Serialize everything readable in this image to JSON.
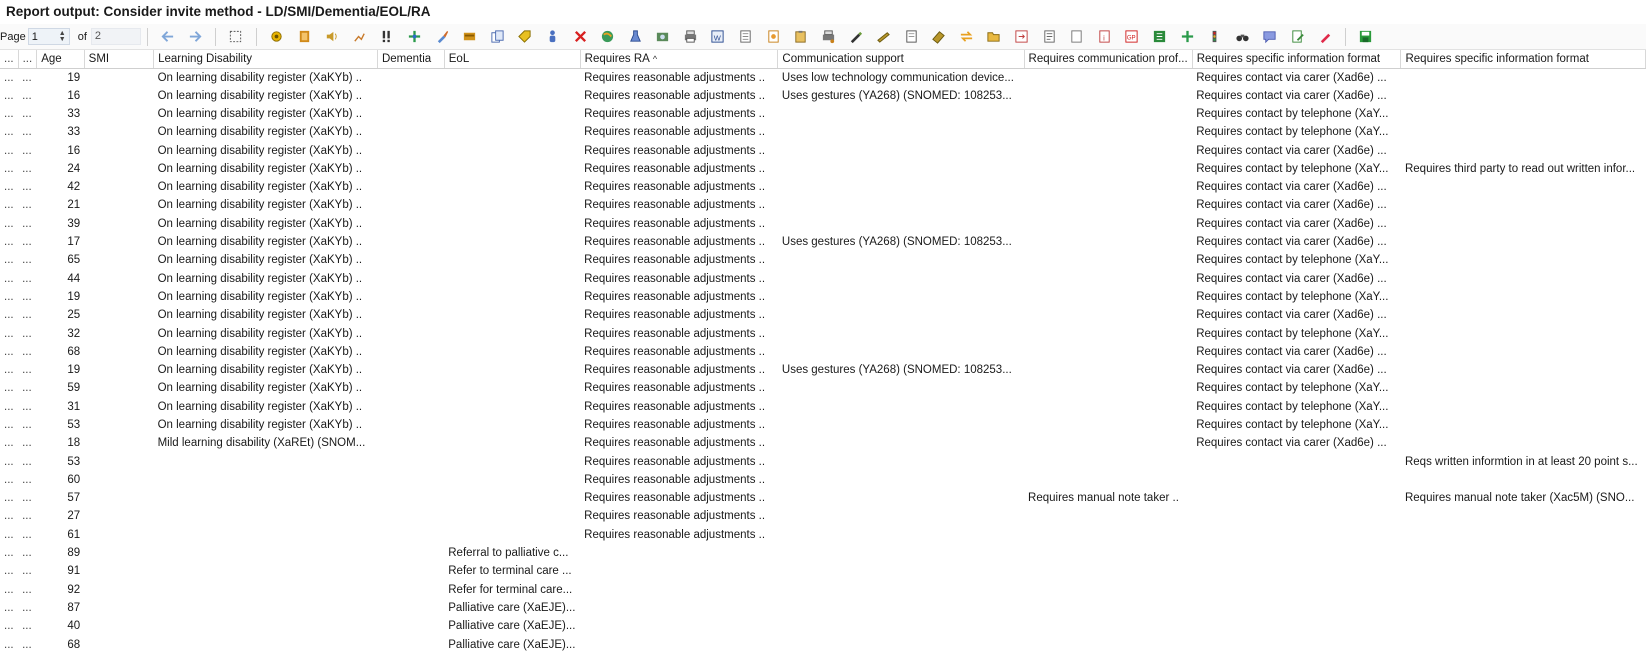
{
  "window": {
    "title": "Report output: Consider invite method - LD/SMI/Dementia/EOL/RA"
  },
  "pager": {
    "page_label": "Page",
    "page_value": "1",
    "of_label": "of",
    "total": "2"
  },
  "toolbar": {
    "icons": [
      "back-arrow-icon",
      "forward-arrow-icon",
      "select-icon",
      "sun-icon",
      "notebook-icon",
      "speaker-icon",
      "chart-edit-icon",
      "exclamation-icon",
      "add-icon",
      "brush-icon",
      "card-icon",
      "document-copy-icon",
      "tag-icon",
      "person-icon",
      "delete-icon",
      "globe-icon",
      "flask-icon",
      "camera-icon",
      "print-icon",
      "word-doc-icon",
      "sheet-icon",
      "report-icon",
      "clipboard-icon",
      "printer-settings-icon",
      "pen-icon",
      "wand-icon",
      "page-icon",
      "eraser-icon",
      "swap-icon",
      "folder-open-icon",
      "export-icon",
      "list-icon",
      "document-icon",
      "info-icon",
      "gp-icon",
      "spreadsheet-green-icon",
      "plus-green-icon",
      "traffic-light-icon",
      "binoculars-icon",
      "comment-icon",
      "edit-document-icon",
      "red-pen-icon",
      "save-icon"
    ]
  },
  "columns": [
    "...",
    "...",
    "Age",
    "SMI",
    "Learning Disability",
    "Dementia",
    "EoL",
    "Requires RA",
    "Communication support",
    "Requires communication prof...",
    "Requires specific information format",
    "Requires specific information format"
  ],
  "sort_indicator": "^",
  "rows": [
    [
      "...",
      "...",
      "19",
      "",
      "On learning disability register (XaKYb) ..",
      "",
      "",
      "Requires reasonable adjustments ..",
      "Uses low technology communication device...",
      "",
      "Requires contact via carer (Xad6e) ...",
      ""
    ],
    [
      "...",
      "...",
      "16",
      "",
      "On learning disability register (XaKYb) ..",
      "",
      "",
      "Requires reasonable adjustments ..",
      "Uses gestures (YA268) (SNOMED: 108253...",
      "",
      "Requires contact via carer (Xad6e) ...",
      ""
    ],
    [
      "...",
      "...",
      "33",
      "",
      "On learning disability register (XaKYb) ..",
      "",
      "",
      "Requires reasonable adjustments ..",
      "",
      "",
      "Requires contact by telephone (XaY...",
      ""
    ],
    [
      "...",
      "...",
      "33",
      "",
      "On learning disability register (XaKYb) ..",
      "",
      "",
      "Requires reasonable adjustments ..",
      "",
      "",
      "Requires contact by telephone (XaY...",
      ""
    ],
    [
      "...",
      "...",
      "16",
      "",
      "On learning disability register (XaKYb) ..",
      "",
      "",
      "Requires reasonable adjustments ..",
      "",
      "",
      "Requires contact via carer (Xad6e) ...",
      ""
    ],
    [
      "...",
      "...",
      "24",
      "",
      "On learning disability register (XaKYb) ..",
      "",
      "",
      "Requires reasonable adjustments ..",
      "",
      "",
      "Requires contact by telephone (XaY...",
      "Requires third party to read out written infor..."
    ],
    [
      "...",
      "...",
      "42",
      "",
      "On learning disability register (XaKYb) ..",
      "",
      "",
      "Requires reasonable adjustments ..",
      "",
      "",
      "Requires contact via carer (Xad6e) ...",
      ""
    ],
    [
      "...",
      "...",
      "21",
      "",
      "On learning disability register (XaKYb) ..",
      "",
      "",
      "Requires reasonable adjustments ..",
      "",
      "",
      "Requires contact via carer (Xad6e) ...",
      ""
    ],
    [
      "...",
      "...",
      "39",
      "",
      "On learning disability register (XaKYb) ..",
      "",
      "",
      "Requires reasonable adjustments ..",
      "",
      "",
      "Requires contact via carer (Xad6e) ...",
      ""
    ],
    [
      "...",
      "...",
      "17",
      "",
      "On learning disability register (XaKYb) ..",
      "",
      "",
      "Requires reasonable adjustments ..",
      "Uses gestures (YA268) (SNOMED: 108253...",
      "",
      "Requires contact via carer (Xad6e) ...",
      ""
    ],
    [
      "...",
      "...",
      "65",
      "",
      "On learning disability register (XaKYb) ..",
      "",
      "",
      "Requires reasonable adjustments ..",
      "",
      "",
      "Requires contact by telephone (XaY...",
      ""
    ],
    [
      "...",
      "...",
      "44",
      "",
      "On learning disability register (XaKYb) ..",
      "",
      "",
      "Requires reasonable adjustments ..",
      "",
      "",
      "Requires contact via carer (Xad6e) ...",
      ""
    ],
    [
      "...",
      "...",
      "19",
      "",
      "On learning disability register (XaKYb) ..",
      "",
      "",
      "Requires reasonable adjustments ..",
      "",
      "",
      "Requires contact by telephone (XaY...",
      ""
    ],
    [
      "...",
      "...",
      "25",
      "",
      "On learning disability register (XaKYb) ..",
      "",
      "",
      "Requires reasonable adjustments ..",
      "",
      "",
      "Requires contact via carer (Xad6e) ...",
      ""
    ],
    [
      "...",
      "...",
      "32",
      "",
      "On learning disability register (XaKYb) ..",
      "",
      "",
      "Requires reasonable adjustments ..",
      "",
      "",
      "Requires contact by telephone (XaY...",
      ""
    ],
    [
      "...",
      "...",
      "68",
      "",
      "On learning disability register (XaKYb) ..",
      "",
      "",
      "Requires reasonable adjustments ..",
      "",
      "",
      "Requires contact via carer (Xad6e) ...",
      ""
    ],
    [
      "...",
      "...",
      "19",
      "",
      "On learning disability register (XaKYb) ..",
      "",
      "",
      "Requires reasonable adjustments ..",
      "Uses gestures (YA268) (SNOMED: 108253...",
      "",
      "Requires contact via carer (Xad6e) ...",
      ""
    ],
    [
      "...",
      "...",
      "59",
      "",
      "On learning disability register (XaKYb) ..",
      "",
      "",
      "Requires reasonable adjustments ..",
      "",
      "",
      "Requires contact by telephone (XaY...",
      ""
    ],
    [
      "...",
      "...",
      "31",
      "",
      "On learning disability register (XaKYb) ..",
      "",
      "",
      "Requires reasonable adjustments ..",
      "",
      "",
      "Requires contact by telephone (XaY...",
      ""
    ],
    [
      "...",
      "...",
      "53",
      "",
      "On learning disability register (XaKYb) ..",
      "",
      "",
      "Requires reasonable adjustments ..",
      "",
      "",
      "Requires contact by telephone (XaY...",
      ""
    ],
    [
      "...",
      "...",
      "18",
      "",
      "Mild learning disability (XaREt) (SNOM...",
      "",
      "",
      "Requires reasonable adjustments ..",
      "",
      "",
      "Requires contact via carer (Xad6e) ...",
      ""
    ],
    [
      "...",
      "...",
      "53",
      "",
      "",
      "",
      "",
      "Requires reasonable adjustments ..",
      "",
      "",
      "",
      "Reqs written informtion in at least 20 point s..."
    ],
    [
      "...",
      "...",
      "60",
      "",
      "",
      "",
      "",
      "Requires reasonable adjustments ..",
      "",
      "",
      "",
      ""
    ],
    [
      "...",
      "...",
      "57",
      "",
      "",
      "",
      "",
      "Requires reasonable adjustments ..",
      "",
      "Requires manual note taker ..",
      "",
      "Requires manual note taker (Xac5M) (SNO..."
    ],
    [
      "...",
      "...",
      "27",
      "",
      "",
      "",
      "",
      "Requires reasonable adjustments ..",
      "",
      "",
      "",
      ""
    ],
    [
      "...",
      "...",
      "61",
      "",
      "",
      "",
      "",
      "Requires reasonable adjustments ..",
      "",
      "",
      "",
      ""
    ],
    [
      "...",
      "...",
      "89",
      "",
      "",
      "",
      "Referral to palliative c...",
      "",
      "",
      "",
      "",
      ""
    ],
    [
      "...",
      "...",
      "91",
      "",
      "",
      "",
      "Refer to terminal care ...",
      "",
      "",
      "",
      "",
      ""
    ],
    [
      "...",
      "...",
      "92",
      "",
      "",
      "",
      "Refer for terminal care...",
      "",
      "",
      "",
      "",
      ""
    ],
    [
      "...",
      "...",
      "87",
      "",
      "",
      "",
      "Palliative care (XaEJE)...",
      "",
      "",
      "",
      "",
      ""
    ],
    [
      "...",
      "...",
      "40",
      "",
      "",
      "",
      "Palliative care (XaEJE)...",
      "",
      "",
      "",
      "",
      ""
    ],
    [
      "...",
      "...",
      "68",
      "",
      "",
      "",
      "Palliative care (XaEJE)...",
      "",
      "",
      "",
      "",
      ""
    ]
  ]
}
